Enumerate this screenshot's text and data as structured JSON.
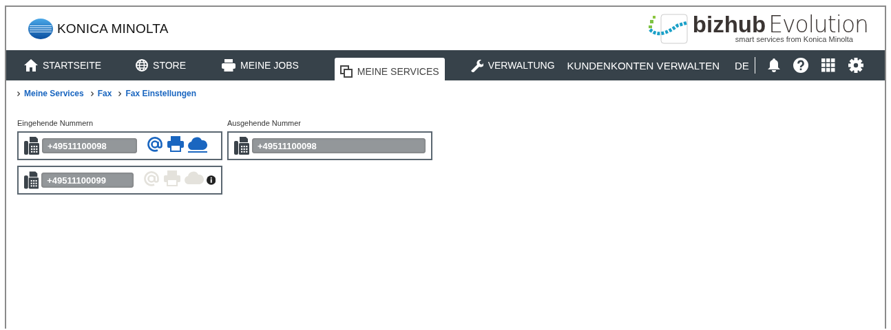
{
  "header": {
    "brand": "KONICA MINOLTA",
    "product_bold": "bizhub",
    "product_light": "Evolution",
    "tagline": "smart services from Konica Minolta"
  },
  "nav": {
    "items": [
      {
        "label": "STARTSEITE",
        "kind": "home",
        "selected": false
      },
      {
        "label": "STORE",
        "kind": "globe",
        "selected": false
      },
      {
        "label": "MEINE JOBS",
        "kind": "print",
        "selected": false
      },
      {
        "label": "MEINE SERVICES",
        "kind": "services",
        "selected": true
      },
      {
        "label": "VERWALTUNG",
        "kind": "wrench",
        "selected": false
      },
      {
        "label": "KUNDENKONTEN VERWALTEN",
        "kind": "plain",
        "selected": false
      }
    ],
    "language": "DE"
  },
  "breadcrumb": [
    "Meine Services",
    "Fax",
    "Fax Einstellungen"
  ],
  "incoming": {
    "label": "Eingehende Nummern",
    "numbers": [
      {
        "number": "+49511100098",
        "info": false,
        "targets": [
          {
            "kind": "email",
            "on": true,
            "selected": false
          },
          {
            "kind": "print",
            "on": true,
            "selected": false
          },
          {
            "kind": "cloud",
            "on": true,
            "selected": true
          }
        ]
      },
      {
        "number": "+49511100099",
        "info": true,
        "targets": [
          {
            "kind": "email",
            "on": false,
            "selected": false
          },
          {
            "kind": "print",
            "on": false,
            "selected": false
          },
          {
            "kind": "cloud",
            "on": false,
            "selected": false
          }
        ]
      }
    ]
  },
  "outgoing": {
    "label": "Ausgehende Nummer",
    "number": "+49511100098"
  }
}
